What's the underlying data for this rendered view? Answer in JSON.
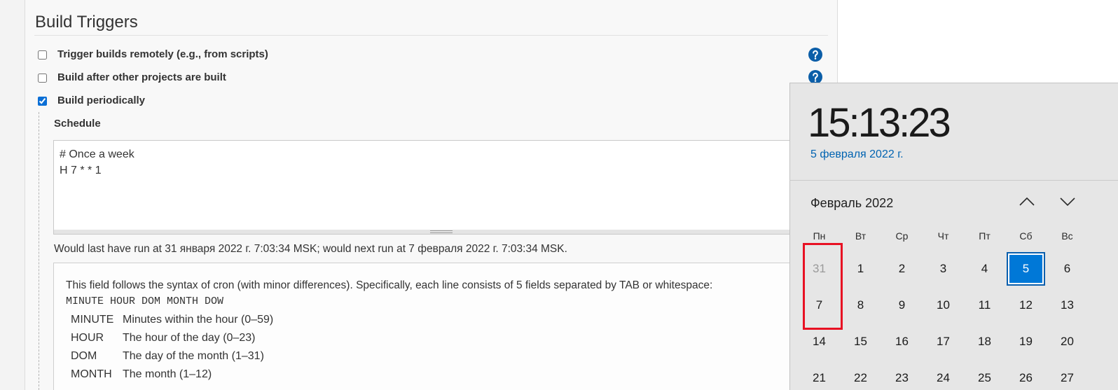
{
  "colors": {
    "panel_background": "#f8f8f8",
    "help_icon": "#0b5ea8",
    "checkbox_accent": "#0b6fd6",
    "flyout_background": "#e6e6e6",
    "date_link": "#0063b1",
    "today_fill": "#0078d7",
    "today_border": "#0a5fad",
    "muted_day": "#9a9a9a",
    "annotation_red": "#e81123"
  },
  "build_triggers": {
    "title": "Build Triggers",
    "options": [
      {
        "label": "Trigger builds remotely (e.g., from scripts)",
        "checked": false,
        "help_icon": "help-icon"
      },
      {
        "label": "Build after other projects are built",
        "checked": false,
        "help_icon": "help-icon"
      },
      {
        "label": "Build periodically",
        "checked": true
      }
    ],
    "schedule": {
      "label": "Schedule",
      "value": "# Once a week\nH 7 * * 1",
      "run_info": "Would last have run at 31 января 2022 г. 7:03:34 MSK; would next run at 7 февраля 2022 г. 7:03:34 MSK."
    },
    "cron_help": {
      "intro": "This field follows the syntax of cron (with minor differences). Specifically, each line consists of 5 fields separated by TAB or whitespace:",
      "syntax": "MINUTE HOUR DOM MONTH DOW",
      "fields": [
        {
          "name": "MINUTE",
          "description": "Minutes within the hour (0–59)"
        },
        {
          "name": "HOUR",
          "description": "The hour of the day (0–23)"
        },
        {
          "name": "DOM",
          "description": "The day of the month (1–31)"
        },
        {
          "name": "MONTH",
          "description": "The month (1–12)"
        }
      ]
    }
  },
  "clock_flyout": {
    "time": "15:13:23",
    "date": "5 февраля 2022 г.",
    "month": "Февраль 2022",
    "prev_month_icon": "chevron-up-icon",
    "next_month_icon": "chevron-down-icon",
    "weekdays": [
      "Пн",
      "Вт",
      "Ср",
      "Чт",
      "Пт",
      "Сб",
      "Вс"
    ],
    "weeks": [
      [
        "31",
        "1",
        "2",
        "3",
        "4",
        "5",
        "6"
      ],
      [
        "7",
        "8",
        "9",
        "10",
        "11",
        "12",
        "13"
      ],
      [
        "14",
        "15",
        "16",
        "17",
        "18",
        "19",
        "20"
      ],
      [
        "21",
        "22",
        "23",
        "24",
        "25",
        "26",
        "27"
      ]
    ]
  }
}
